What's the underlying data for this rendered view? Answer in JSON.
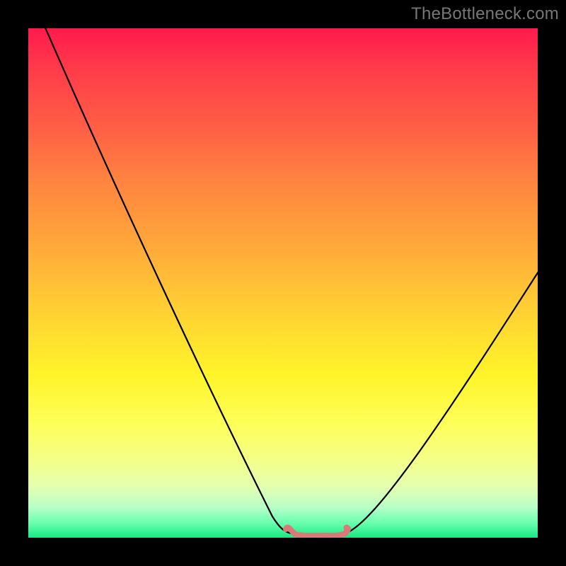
{
  "watermark": "TheBottleneck.com",
  "colors": {
    "frame": "#000000",
    "curve": "#000000",
    "flat_marker": "#d97a78",
    "gradient_top": "#ff1a4d",
    "gradient_bottom": "#17e983"
  },
  "chart_data": {
    "type": "line",
    "title": "",
    "xlabel": "",
    "ylabel": "",
    "xlim": [
      0,
      100
    ],
    "ylim": [
      0,
      100
    ],
    "grid": false,
    "legend": false,
    "annotations": [],
    "series": [
      {
        "name": "bottleneck-curve",
        "x": [
          0,
          5,
          10,
          15,
          20,
          25,
          30,
          35,
          40,
          45,
          48,
          50,
          52,
          55,
          57,
          60,
          63,
          67,
          72,
          78,
          85,
          92,
          100
        ],
        "y": [
          100,
          92,
          84,
          76,
          67,
          58,
          49,
          40,
          30,
          19,
          10,
          4,
          1,
          0,
          0,
          1,
          3,
          7,
          13,
          21,
          31,
          42,
          55
        ]
      }
    ],
    "flat_region": {
      "x_start": 48,
      "x_end": 62,
      "y": 1
    },
    "notes": "V-shaped curve over a vertical red→green gradient; no axis ticks or numeric labels are visible."
  }
}
